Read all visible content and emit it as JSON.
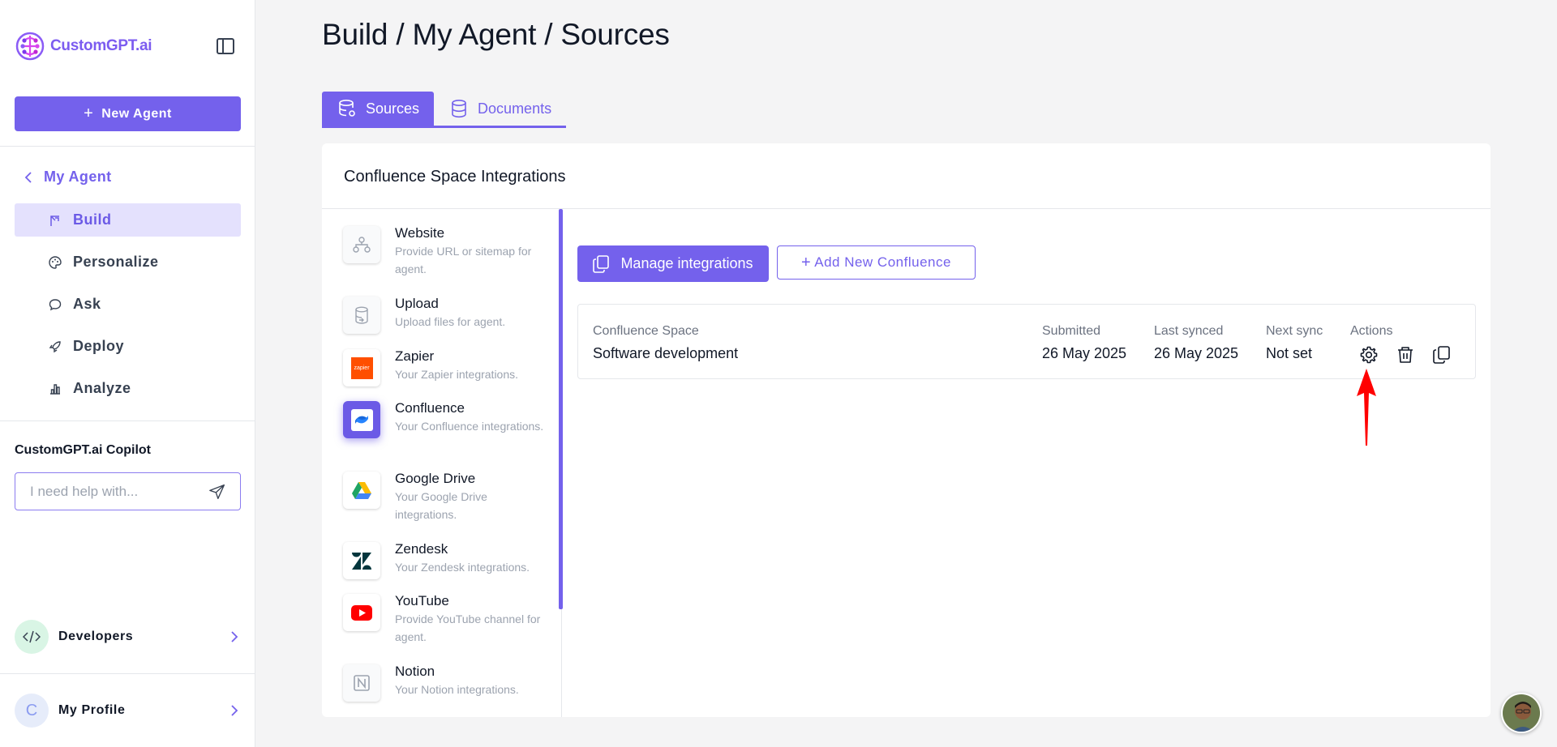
{
  "app": {
    "brand": "CustomGPT.ai"
  },
  "sidebar": {
    "new_agent_label": "New Agent",
    "back_label": "My Agent",
    "nav": [
      {
        "label": "Build",
        "icon": "build-icon",
        "active": true
      },
      {
        "label": "Personalize",
        "icon": "palette-icon",
        "active": false
      },
      {
        "label": "Ask",
        "icon": "chat-icon",
        "active": false
      },
      {
        "label": "Deploy",
        "icon": "rocket-icon",
        "active": false
      },
      {
        "label": "Analyze",
        "icon": "chart-icon",
        "active": false
      }
    ],
    "copilot": {
      "title": "CustomGPT.ai Copilot",
      "placeholder": "I need help with..."
    },
    "developers_label": "Developers",
    "profile": {
      "initial": "C",
      "label": "My Profile"
    }
  },
  "header": {
    "title": "Build / My Agent / Sources"
  },
  "tabs": [
    {
      "label": "Sources",
      "active": true
    },
    {
      "label": "Documents",
      "active": false
    }
  ],
  "card": {
    "title": "Confluence Space Integrations",
    "sources": [
      {
        "name": "Website",
        "desc": "Provide URL or sitemap for agent."
      },
      {
        "name": "Upload",
        "desc": "Upload files for agent."
      },
      {
        "name": "Zapier",
        "desc": "Your Zapier integrations."
      },
      {
        "name": "Confluence",
        "desc": "Your Confluence integrations.",
        "active": true
      },
      {
        "name": "Google Drive",
        "desc": "Your Google Drive integrations."
      },
      {
        "name": "Zendesk",
        "desc": "Your Zendesk integrations."
      },
      {
        "name": "YouTube",
        "desc": "Provide YouTube channel for agent."
      },
      {
        "name": "Notion",
        "desc": "Your Notion integrations."
      }
    ],
    "zapier_logo_text": "zapier",
    "manage_label": "Manage integrations",
    "add_label": "Add New Confluence",
    "table": {
      "headers": {
        "space": "Confluence Space",
        "submitted": "Submitted",
        "last_synced": "Last synced",
        "next_sync": "Next sync",
        "actions": "Actions"
      },
      "row": {
        "space": "Software development",
        "submitted": "26 May 2025",
        "last_synced": "26 May 2025",
        "next_sync": "Not set"
      }
    }
  },
  "colors": {
    "accent": "#7461ec",
    "accent_light": "#e4e1fd",
    "annotation_arrow": "#ff0000"
  }
}
